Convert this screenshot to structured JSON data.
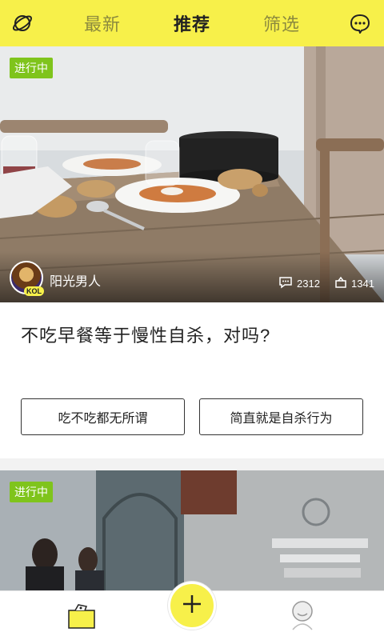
{
  "topbar": {
    "left_icon": "planet-icon",
    "right_icon": "chat-bubble-icon",
    "tabs": [
      {
        "label": "最新"
      },
      {
        "label": "推荐"
      },
      {
        "label": "筛选"
      }
    ],
    "active_tab": "推荐"
  },
  "card1": {
    "badge": "进行中",
    "author": "阳光男人",
    "author_tag": "KOL",
    "comment_count": "2312",
    "share_count": "1341",
    "question": "不吃早餐等于慢性自杀，对吗?",
    "answers": [
      {
        "label": "吃不吃都无所谓"
      },
      {
        "label": "简直就是自杀行为"
      }
    ]
  },
  "card2": {
    "badge": "进行中"
  },
  "bottombar": {
    "left_icon": "folder-envelope-icon",
    "center_icon": "plus-icon",
    "right_icon": "person-icon"
  },
  "colors": {
    "brand_yellow": "#f7f04a",
    "badge_green": "#7fc41c"
  }
}
